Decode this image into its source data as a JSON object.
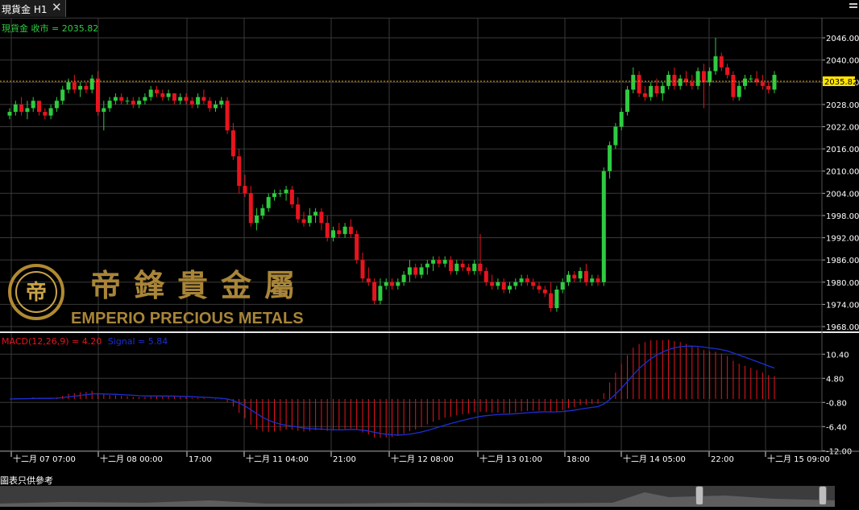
{
  "tab": {
    "label": "現貨金 H1",
    "close": "✕"
  },
  "price": {
    "label": "現貨金 收市 = 2035.82",
    "last": "2035.82",
    "y_ticks": [
      "2046.00",
      "2040.00",
      "2034.00",
      "2028.00",
      "2022.00",
      "2016.00",
      "2010.00",
      "2004.00",
      "1998.00",
      "1992.00",
      "1986.00",
      "1980.00",
      "1974.00",
      "1968.00"
    ]
  },
  "macd": {
    "label": "MACD(12,26,9) = 4.20",
    "signal_label": "Signal = 5.84",
    "y_ticks": [
      "10.40",
      "4.80",
      "-0.80",
      "-6.40",
      "-12.00"
    ]
  },
  "x_labels": [
    "十二月 07 07:00",
    "十二月 08 00:00",
    "17:00",
    "十二月 11 04:00",
    "21:00",
    "十二月 12 08:00",
    "十二月 13 01:00",
    "18:00",
    "十二月 14 05:00",
    "22:00",
    "十二月 15 09:00"
  ],
  "watermark": {
    "chinese": "帝鋒貴金屬",
    "english": "EMPERIO PRECIOUS METALS"
  },
  "footer": {
    "note": "圖表只供參考"
  },
  "colors": {
    "up": "#2ecc40",
    "down": "#e8141e",
    "signal": "#1c2fd6",
    "grid": "#3a3a3a",
    "axis_text": "#ffffff",
    "last_price_bg": "#ffe400"
  },
  "chart_data": {
    "type": "candlestick",
    "timeframe": "H1",
    "ylim": [
      1968,
      2048
    ],
    "candles": [
      [
        2025,
        2027,
        2024,
        2026
      ],
      [
        2026,
        2029,
        2025,
        2028
      ],
      [
        2028,
        2030,
        2025,
        2026
      ],
      [
        2026,
        2029,
        2024,
        2027
      ],
      [
        2027,
        2030,
        2026,
        2029
      ],
      [
        2029,
        2028,
        2025,
        2026
      ],
      [
        2026,
        2027,
        2024,
        2025
      ],
      [
        2025,
        2028,
        2024,
        2027
      ],
      [
        2027,
        2030,
        2026,
        2029
      ],
      [
        2029,
        2033,
        2028,
        2032
      ],
      [
        2032,
        2035,
        2031,
        2034
      ],
      [
        2034,
        2036,
        2031,
        2032
      ],
      [
        2032,
        2034,
        2030,
        2033
      ],
      [
        2033,
        2034,
        2031,
        2032
      ],
      [
        2032,
        2036,
        2031,
        2035
      ],
      [
        2035,
        2037,
        2025,
        2026
      ],
      [
        2026,
        2029,
        2021,
        2027
      ],
      [
        2027,
        2030,
        2026,
        2029
      ],
      [
        2029,
        2031,
        2028,
        2030
      ],
      [
        2030,
        2031,
        2028,
        2029
      ],
      [
        2029,
        2030,
        2028,
        2029
      ],
      [
        2029,
        2030,
        2027,
        2028
      ],
      [
        2028,
        2030,
        2027,
        2029
      ],
      [
        2029,
        2031,
        2028,
        2030
      ],
      [
        2030,
        2033,
        2029,
        2032
      ],
      [
        2032,
        2033,
        2030,
        2031
      ],
      [
        2031,
        2032,
        2029,
        2030
      ],
      [
        2030,
        2032,
        2029,
        2031
      ],
      [
        2031,
        2031,
        2028,
        2029
      ],
      [
        2029,
        2031,
        2028,
        2030
      ],
      [
        2030,
        2031,
        2028,
        2029
      ],
      [
        2029,
        2030,
        2027,
        2028
      ],
      [
        2028,
        2031,
        2027,
        2030
      ],
      [
        2030,
        2032,
        2028,
        2029
      ],
      [
        2029,
        2030,
        2026,
        2027
      ],
      [
        2027,
        2029,
        2026,
        2028
      ],
      [
        2028,
        2030,
        2027,
        2029
      ],
      [
        2029,
        2030,
        2020,
        2021
      ],
      [
        2021,
        2023,
        2013,
        2014
      ],
      [
        2014,
        2016,
        2004,
        2006
      ],
      [
        2006,
        2009,
        2003,
        2004
      ],
      [
        2004,
        2006,
        1995,
        1996
      ],
      [
        1996,
        2000,
        1994,
        1998
      ],
      [
        1998,
        2001,
        1997,
        2000
      ],
      [
        2000,
        2004,
        1999,
        2003
      ],
      [
        2003,
        2005,
        2002,
        2004
      ],
      [
        2004,
        2005,
        2003,
        2004
      ],
      [
        2004,
        2006,
        2002,
        2005
      ],
      [
        2005,
        2006,
        2000,
        2001
      ],
      [
        2001,
        2003,
        1996,
        1997
      ],
      [
        1997,
        1999,
        1995,
        1996
      ],
      [
        1996,
        2000,
        1995,
        1998
      ],
      [
        1998,
        2000,
        1996,
        1999
      ],
      [
        1999,
        2000,
        1994,
        1996
      ],
      [
        1996,
        1998,
        1991,
        1992
      ],
      [
        1992,
        1995,
        1991,
        1994
      ],
      [
        1994,
        1996,
        1992,
        1993
      ],
      [
        1993,
        1996,
        1992,
        1995
      ],
      [
        1995,
        1997,
        1992,
        1993
      ],
      [
        1993,
        1994,
        1985,
        1986
      ],
      [
        1986,
        1988,
        1980,
        1981
      ],
      [
        1981,
        1984,
        1979,
        1980
      ],
      [
        1980,
        1981,
        1974,
        1975
      ],
      [
        1975,
        1981,
        1974,
        1979
      ],
      [
        1979,
        1981,
        1978,
        1980
      ],
      [
        1980,
        1981,
        1978,
        1979
      ],
      [
        1979,
        1981,
        1978,
        1980
      ],
      [
        1980,
        1983,
        1979,
        1982
      ],
      [
        1982,
        1986,
        1980,
        1984
      ],
      [
        1984,
        1985,
        1981,
        1982
      ],
      [
        1982,
        1985,
        1981,
        1984
      ],
      [
        1984,
        1986,
        1982,
        1985
      ],
      [
        1985,
        1987,
        1983,
        1986
      ],
      [
        1986,
        1987,
        1984,
        1985
      ],
      [
        1985,
        1987,
        1984,
        1986
      ],
      [
        1986,
        1987,
        1982,
        1983
      ],
      [
        1983,
        1986,
        1982,
        1985
      ],
      [
        1985,
        1986,
        1983,
        1984
      ],
      [
        1984,
        1985,
        1982,
        1983
      ],
      [
        1983,
        1986,
        1982,
        1985
      ],
      [
        1985,
        1993,
        1982,
        1983
      ],
      [
        1983,
        1984,
        1979,
        1980
      ],
      [
        1980,
        1982,
        1978,
        1979
      ],
      [
        1979,
        1981,
        1978,
        1980
      ],
      [
        1980,
        1981,
        1977,
        1978
      ],
      [
        1978,
        1980,
        1977,
        1979
      ],
      [
        1979,
        1981,
        1978,
        1980
      ],
      [
        1980,
        1982,
        1979,
        1981
      ],
      [
        1981,
        1982,
        1979,
        1980
      ],
      [
        1980,
        1981,
        1978,
        1979
      ],
      [
        1979,
        1980,
        1977,
        1978
      ],
      [
        1978,
        1979,
        1976,
        1977
      ],
      [
        1977,
        1980,
        1972,
        1973
      ],
      [
        1973,
        1979,
        1972,
        1978
      ],
      [
        1978,
        1981,
        1977,
        1980
      ],
      [
        1980,
        1983,
        1979,
        1982
      ],
      [
        1982,
        1983,
        1980,
        1981
      ],
      [
        1981,
        1984,
        1980,
        1983
      ],
      [
        1983,
        1985,
        1979,
        1980
      ],
      [
        1980,
        1982,
        1979,
        1981
      ],
      [
        1981,
        1982,
        1979,
        1980
      ],
      [
        1980,
        2011,
        1979,
        2010
      ],
      [
        2010,
        2018,
        2008,
        2017
      ],
      [
        2017,
        2023,
        2016,
        2022
      ],
      [
        2022,
        2027,
        2021,
        2026
      ],
      [
        2026,
        2033,
        2025,
        2032
      ],
      [
        2032,
        2038,
        2031,
        2036
      ],
      [
        2036,
        2037,
        2030,
        2031
      ],
      [
        2031,
        2033,
        2029,
        2030
      ],
      [
        2030,
        2034,
        2029,
        2033
      ],
      [
        2033,
        2035,
        2030,
        2031
      ],
      [
        2031,
        2034,
        2029,
        2033
      ],
      [
        2033,
        2037,
        2032,
        2036
      ],
      [
        2036,
        2038,
        2032,
        2033
      ],
      [
        2033,
        2036,
        2032,
        2035
      ],
      [
        2035,
        2037,
        2033,
        2034
      ],
      [
        2034,
        2036,
        2032,
        2033
      ],
      [
        2033,
        2038,
        2032,
        2037
      ],
      [
        2037,
        2039,
        2027,
        2034
      ],
      [
        2034,
        2038,
        2033,
        2037
      ],
      [
        2037,
        2046,
        2036,
        2041
      ],
      [
        2041,
        2042,
        2037,
        2038
      ],
      [
        2038,
        2039,
        2035,
        2036
      ],
      [
        2036,
        2037,
        2029,
        2030
      ],
      [
        2030,
        2034,
        2029,
        2033
      ],
      [
        2033,
        2036,
        2032,
        2035
      ],
      [
        2035,
        2036,
        2034,
        2035
      ],
      [
        2035,
        2037,
        2033,
        2034
      ],
      [
        2034,
        2036,
        2032,
        2033
      ],
      [
        2033,
        2034,
        2031,
        2032
      ],
      [
        2032,
        2037,
        2031,
        2036
      ]
    ]
  }
}
